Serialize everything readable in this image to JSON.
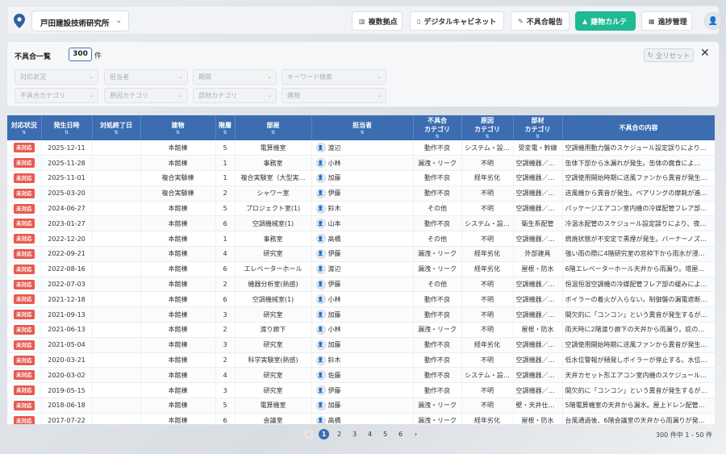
{
  "header": {
    "org_name": "戸田建設技術研究所",
    "nav": [
      {
        "label": "複数拠点",
        "icon": "building-icon",
        "active": false
      },
      {
        "label": "デジタルキャビネット",
        "icon": "document-icon",
        "active": false
      },
      {
        "label": "不具合報告",
        "icon": "edit-icon",
        "active": false
      },
      {
        "label": "建物カルテ",
        "icon": "chart-icon",
        "active": true
      },
      {
        "label": "進捗管理",
        "icon": "calendar-icon",
        "active": false
      }
    ]
  },
  "filter": {
    "title": "不具合一覧",
    "count": "300",
    "count_unit": "件",
    "reset_label": "全リセット",
    "row1": [
      "対応状況",
      "担当者",
      "期間",
      "キーワード検索"
    ],
    "row2": [
      "不具合カテゴリ",
      "原因カテゴリ",
      "部材カテゴリ",
      "建物"
    ]
  },
  "table": {
    "columns": [
      "対応状況",
      "発生日時",
      "対処終了日",
      "建物",
      "階層",
      "部屋",
      "担当者",
      "不具合\nカテゴリ",
      "原因\nカテゴリ",
      "部材\nカテゴリ",
      "不具合の内容"
    ],
    "status_label": "未対応",
    "rows": [
      [
        "2025-12-11",
        "",
        "本館棟",
        "5",
        "電算機室",
        "渡辺",
        "動作不良",
        "システム・設…",
        "受変電・幹線",
        "空調機用動力盤のスケジュール設定誤りにより…"
      ],
      [
        "2025-11-28",
        "",
        "本館棟",
        "1",
        "事務室",
        "小林",
        "漏洩・リーク",
        "不明",
        "空調機器／器…",
        "缶体下部から水漏れが発生。缶体の腐食によ…"
      ],
      [
        "2025-11-01",
        "",
        "複合実験棟",
        "1",
        "複合実験室（大型実…",
        "加藤",
        "動作不良",
        "経年劣化",
        "空調機器／器…",
        "空調使用開始時期に送風ファンから異音が発生…"
      ],
      [
        "2025-03-20",
        "",
        "複合実験棟",
        "2",
        "シャワー室",
        "伊藤",
        "動作不良",
        "不明",
        "空調機器／器…",
        "送風機から異音が発生。ベアリングの摩耗が進…"
      ],
      [
        "2024-06-27",
        "",
        "本館棟",
        "5",
        "プロジェクト室(1)",
        "鈴木",
        "その他",
        "不明",
        "空調機器／器…",
        "パッケージエアコン室内機の冷媒配管フレア部…"
      ],
      [
        "2023-01-27",
        "",
        "本館棟",
        "6",
        "空調機械室(1)",
        "山本",
        "動作不良",
        "システム・設…",
        "衛生系配管",
        "冷温水配管のスケジュール設定誤りにより、夜…"
      ],
      [
        "2022-12-20",
        "",
        "本館棟",
        "1",
        "事務室",
        "高橋",
        "その他",
        "不明",
        "空調機器／器…",
        "燃焼状態が不安定で黒煙が発生。バーナーノズ…"
      ],
      [
        "2022-09-21",
        "",
        "本館棟",
        "4",
        "研究室",
        "伊藤",
        "漏洩・リーク",
        "経年劣化",
        "外部建具",
        "強い雨の際に4階研究室の窓枠下から雨水が浸…"
      ],
      [
        "2022-08-16",
        "",
        "本館棟",
        "6",
        "エレベーターホール",
        "渡辺",
        "漏洩・リーク",
        "経年劣化",
        "屋根・防水",
        "6階エレベーターホール天井から雨漏り。塔屋…"
      ],
      [
        "2022-07-03",
        "",
        "本館棟",
        "2",
        "機器分析室(熱感)",
        "伊藤",
        "その他",
        "不明",
        "空調機器／器…",
        "恒温恒湿空調機の冷媒配管フレア部の緩みによ…"
      ],
      [
        "2021-12-18",
        "",
        "本館棟",
        "6",
        "空調機械室(1)",
        "小林",
        "動作不良",
        "不明",
        "空調機器／器…",
        "ボイラーの着火が入らない。制御盤の漏電遮断…"
      ],
      [
        "2021-09-13",
        "",
        "本館棟",
        "3",
        "研究室",
        "加藤",
        "動作不良",
        "不明",
        "空調機器／器…",
        "間欠的に「コンコン」という異音が発生するが…"
      ],
      [
        "2021-06-13",
        "",
        "本館棟",
        "2",
        "渡り廊下",
        "小林",
        "漏洩・リーク",
        "不明",
        "屋根・防水",
        "雨天時に2階渡り廊下の天井から雨漏り。庇の…"
      ],
      [
        "2021-05-04",
        "",
        "本館棟",
        "3",
        "研究室",
        "加藤",
        "動作不良",
        "経年劣化",
        "空調機器／器…",
        "空調使用開始時期に送風ファンから異音が発生…"
      ],
      [
        "2020-03-21",
        "",
        "本館棟",
        "2",
        "科学実験室(熱感)",
        "鈴木",
        "動作不良",
        "不明",
        "空調機器／器…",
        "低水位警報が頻発しボイラーが停止する。水位…"
      ],
      [
        "2020-03-02",
        "",
        "本館棟",
        "4",
        "研究室",
        "佐藤",
        "動作不良",
        "システム・設…",
        "空調機器／器…",
        "天井カセット形エアコン室内機のスケジュール…"
      ],
      [
        "2019-05-15",
        "",
        "本館棟",
        "3",
        "研究室",
        "伊藤",
        "動作不良",
        "不明",
        "空調機器／器…",
        "間欠的に「コンコン」という異音が発生するが…"
      ],
      [
        "2018-06-18",
        "",
        "本館棟",
        "5",
        "電算機室",
        "加藤",
        "漏洩・リーク",
        "不明",
        "壁・天井仕上…",
        "5階電算機室の天井から漏水。屋上ドレン配管…"
      ],
      [
        "2017-07-22",
        "",
        "本館棟",
        "6",
        "会議室",
        "高橋",
        "漏洩・リーク",
        "経年劣化",
        "屋根・防水",
        "台風通過後、6階会議室の天井から雨漏りが発…"
      ]
    ]
  },
  "pagination": {
    "pages": [
      "1",
      "2",
      "3",
      "4",
      "5",
      "6"
    ],
    "current": "1",
    "info": "300 件中 1 - 50 件"
  }
}
